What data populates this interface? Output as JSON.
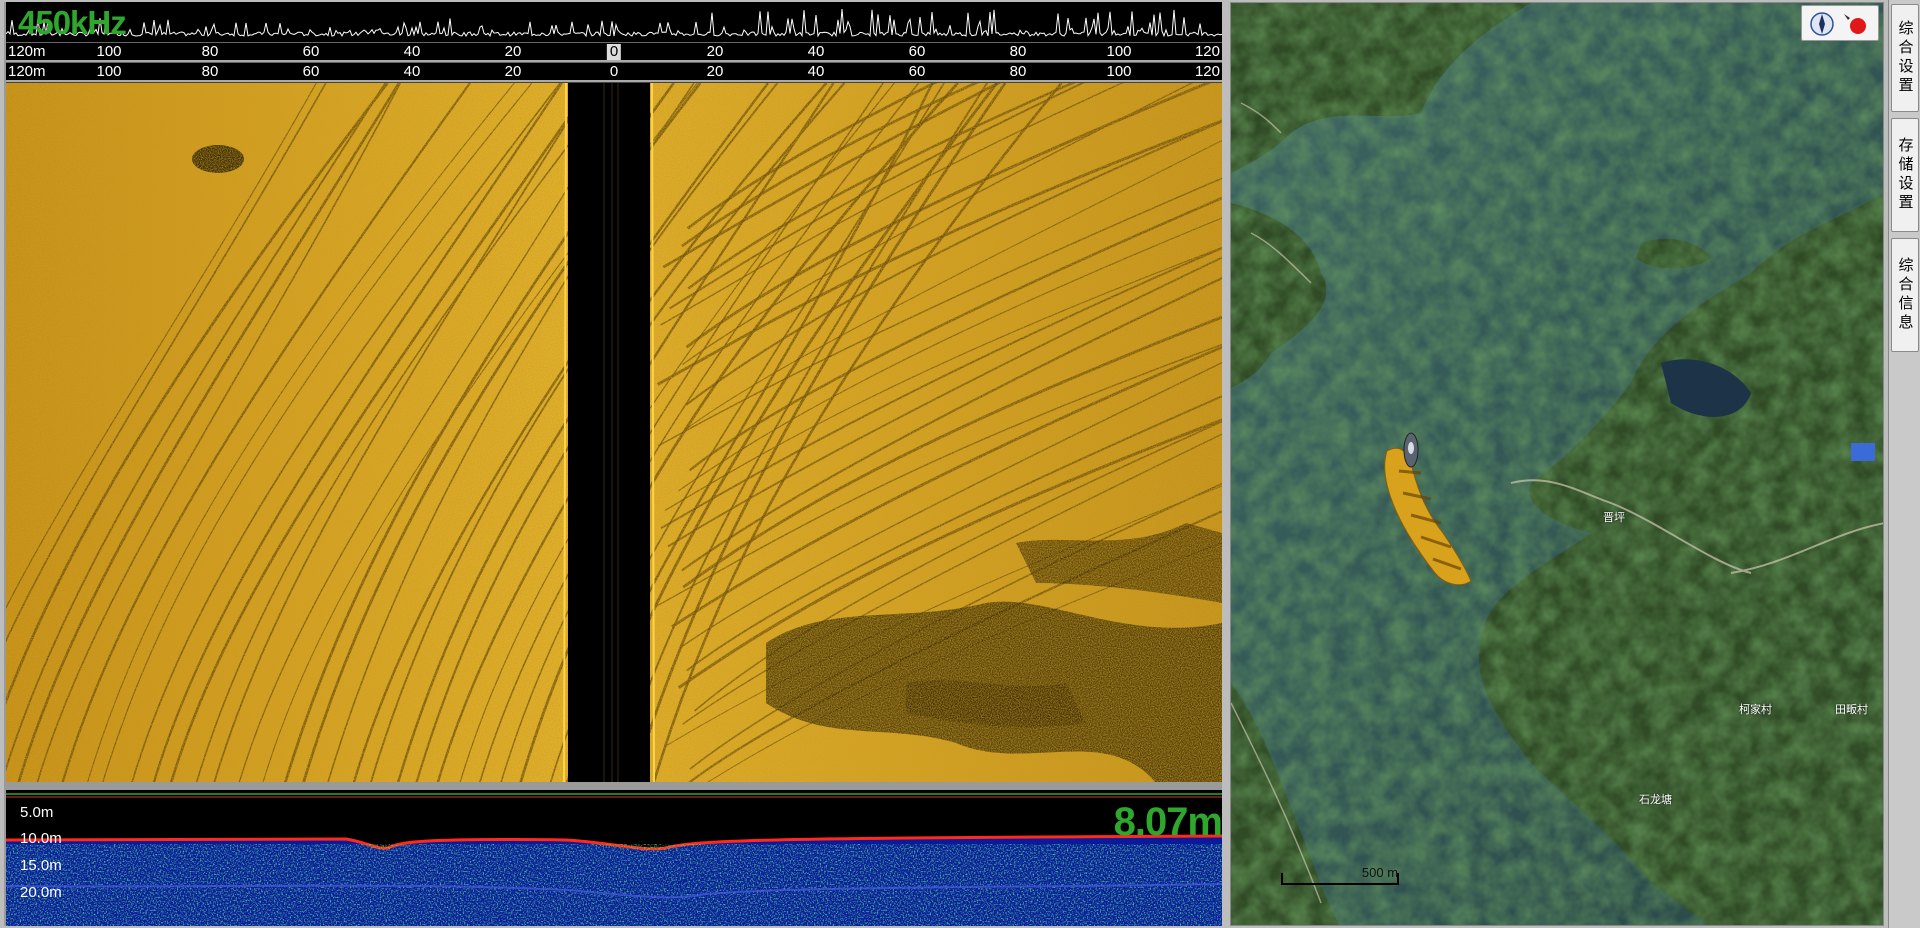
{
  "sonar": {
    "frequency": "450kHz",
    "range_ticks": [
      "120m",
      "100",
      "80",
      "60",
      "40",
      "20",
      "0",
      "20",
      "40",
      "60",
      "80",
      "100",
      "120"
    ],
    "depth_readout": "8.07m",
    "depth_labels": [
      "5.0m",
      "10.0m",
      "15.0m",
      "20.0m"
    ]
  },
  "map": {
    "places": [
      "晋坪",
      "柯家村",
      "田畈村",
      "石龙塘"
    ],
    "scale": "500 m"
  },
  "side_tabs": [
    "综合设置",
    "存储设置",
    "综合信息"
  ],
  "colors": {
    "sonar_amber": "#e0a822",
    "readout_green": "#2da82d",
    "water": "#2f5350",
    "land": "#3d5a2e"
  }
}
